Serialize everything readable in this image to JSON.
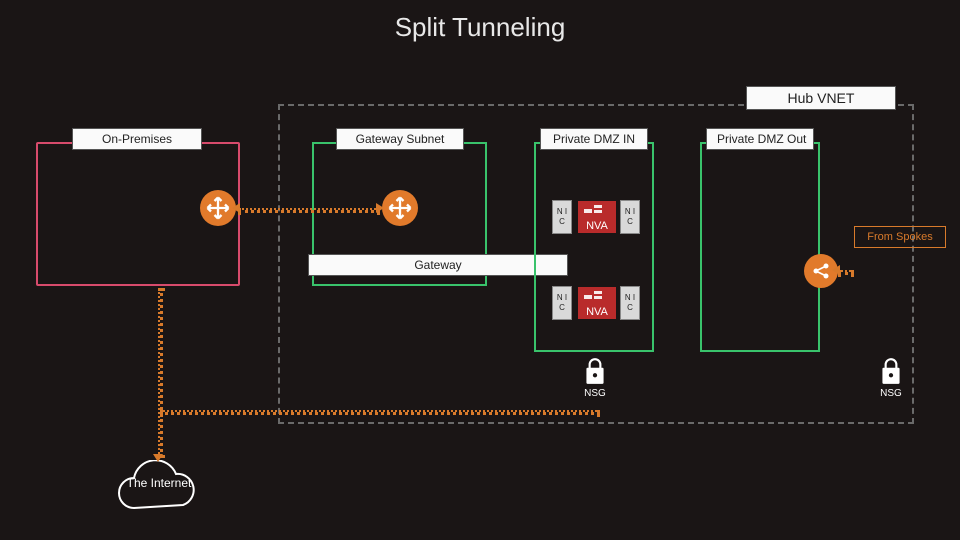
{
  "title": "Split Tunneling",
  "hub_vnet_label": "Hub VNET",
  "on_premises_label": "On-Premises",
  "gateway_subnet_label": "Gateway Subnet",
  "private_dmz_in_label": "Private DMZ IN",
  "private_dmz_out_label": "Private DMZ Out",
  "gateway_label": "Gateway",
  "from_spokes_label": "From Spokes",
  "nic_label": "N\nI\nC",
  "nva_label": "NVA",
  "nsg_label": "NSG",
  "internet_label": "The\nInternet"
}
